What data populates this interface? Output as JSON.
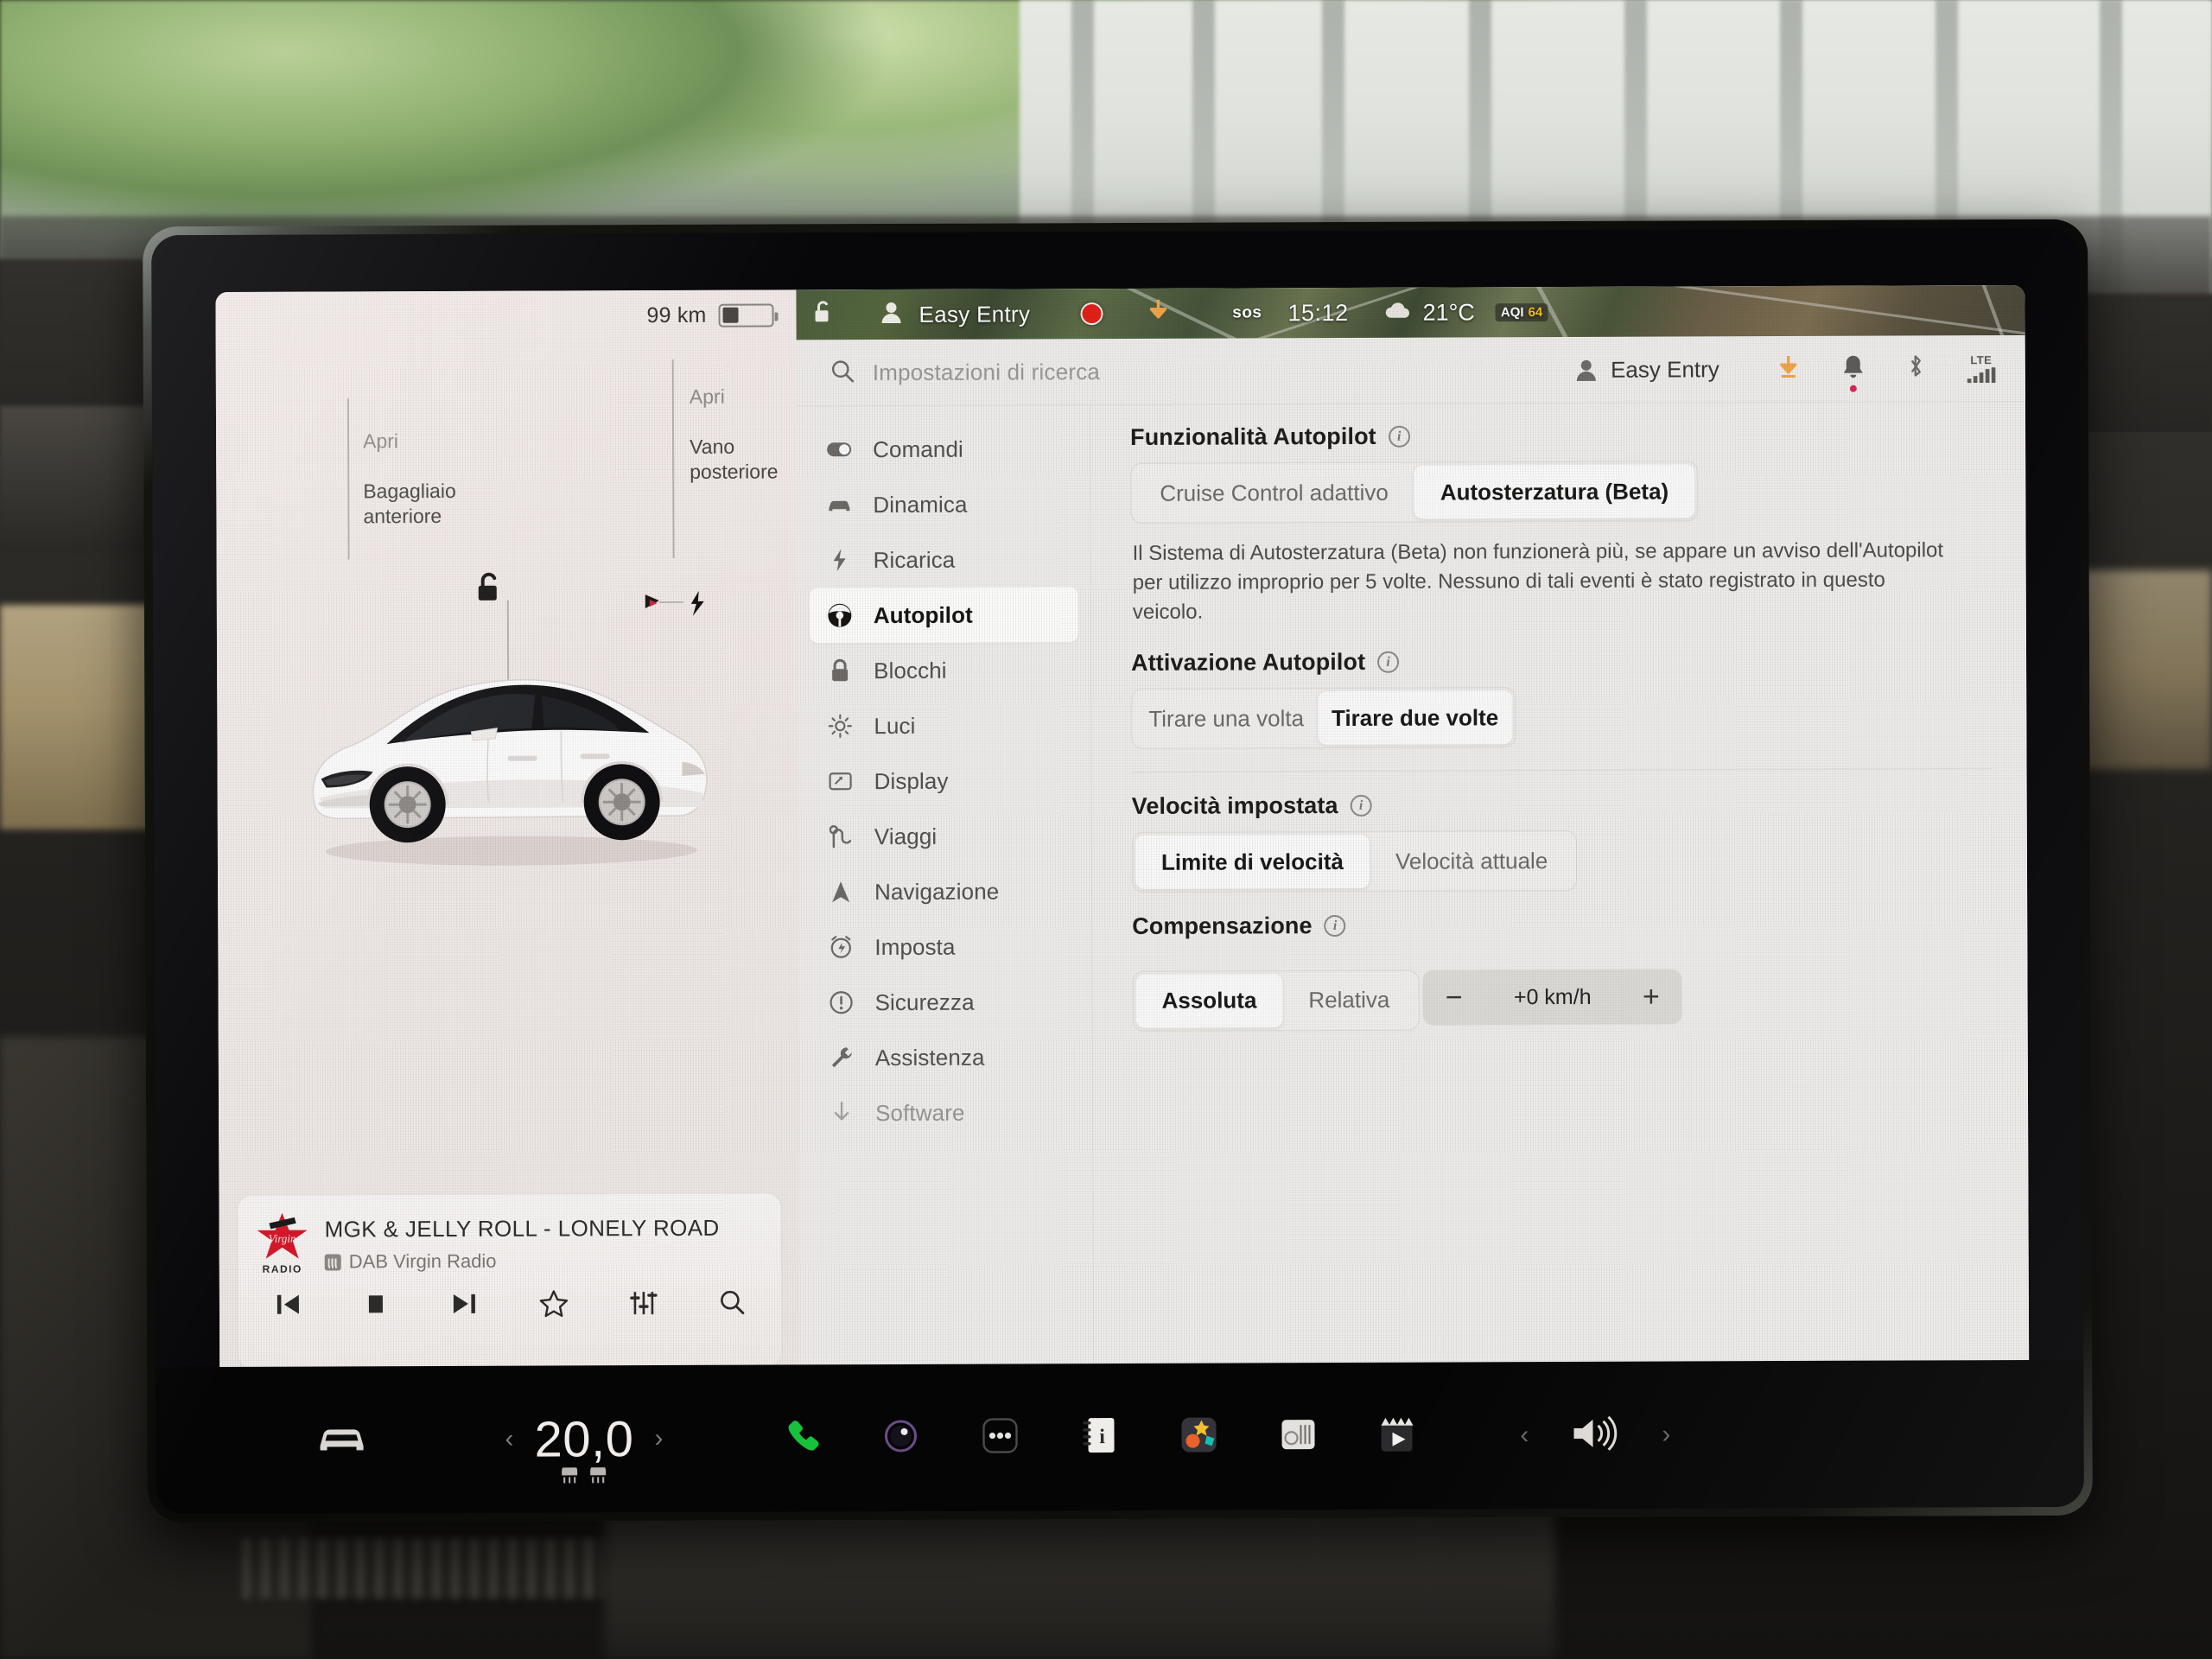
{
  "vehicle_panel": {
    "range_value": "99 km",
    "battery_icon": "battery-icon",
    "front_trunk_label": "Apri",
    "front_trunk_name": "Bagagliaio\nanteriore",
    "rear_trunk_label": "Apri",
    "rear_trunk_name": "Vano\nposteriore",
    "lock_icon": "unlocked-padlock-icon",
    "charge_port_icon": "charge-port-icon",
    "car_image": "tesla-model-3-white"
  },
  "media": {
    "station_logo": "virgin-radio-logo",
    "logo_caption": "RADIO",
    "track_title": "MGK & JELLY ROLL - LONELY ROAD",
    "source": "DAB Virgin Radio",
    "source_badge": "dab-icon",
    "controls": [
      {
        "name": "previous-track-button",
        "icon": "skip-previous-icon"
      },
      {
        "name": "stop-button",
        "icon": "stop-icon"
      },
      {
        "name": "next-track-button",
        "icon": "skip-next-icon"
      },
      {
        "name": "favorite-button",
        "icon": "star-outline-icon"
      },
      {
        "name": "equalizer-button",
        "icon": "equalizer-icon"
      },
      {
        "name": "media-search-button",
        "icon": "search-icon"
      }
    ]
  },
  "status_bar": {
    "lock_icon": "unlocked-padlock-icon",
    "profile_icon": "person-icon",
    "profile_name": "Easy Entry",
    "record_indicator": "sentry-record-icon",
    "navigation_arrow": "download-arrow-icon",
    "sos_label": "sos",
    "time": "15:12",
    "weather_icon": "cloud-icon",
    "temperature": "21°C",
    "aqi_label": "AQI",
    "aqi_value": "64"
  },
  "search": {
    "icon": "search-icon",
    "placeholder": "Impostazioni di ricerca",
    "value": ""
  },
  "header_right": {
    "profile_icon": "person-icon",
    "profile_name": "Easy Entry",
    "icons": [
      {
        "name": "software-download-icon"
      },
      {
        "name": "notification-bell-icon"
      },
      {
        "name": "bluetooth-icon"
      }
    ],
    "connection_label": "LTE",
    "signal_icon": "signal-bars-icon"
  },
  "nav": {
    "items": [
      {
        "label": "Comandi",
        "icon": "toggle-switch-icon",
        "active": false
      },
      {
        "label": "Dinamica",
        "icon": "car-front-icon",
        "active": false
      },
      {
        "label": "Ricarica",
        "icon": "bolt-icon",
        "active": false
      },
      {
        "label": "Autopilot",
        "icon": "steering-wheel-icon",
        "active": true
      },
      {
        "label": "Blocchi",
        "icon": "padlock-icon",
        "active": false
      },
      {
        "label": "Luci",
        "icon": "sun-icon",
        "active": false
      },
      {
        "label": "Display",
        "icon": "display-icon",
        "active": false
      },
      {
        "label": "Viaggi",
        "icon": "trips-icon",
        "active": false
      },
      {
        "label": "Navigazione",
        "icon": "navigation-arrow-icon",
        "active": false
      },
      {
        "label": "Imposta",
        "icon": "alarm-clock-icon",
        "active": false
      },
      {
        "label": "Sicurezza",
        "icon": "warning-circle-icon",
        "active": false
      },
      {
        "label": "Assistenza",
        "icon": "wrench-icon",
        "active": false
      },
      {
        "label": "Software",
        "icon": "download-arrow-icon",
        "active": false
      }
    ]
  },
  "content": {
    "sections": [
      {
        "title": "Funzionalità Autopilot",
        "info_icon": "info-icon",
        "options": [
          {
            "label": "Cruise Control adattivo",
            "selected": false
          },
          {
            "label": "Autosterzatura (Beta)",
            "selected": true
          }
        ],
        "description": "Il Sistema di Autosterzatura (Beta) non funzionerà più, se appare un avviso dell'Autopilot per utilizzo improprio per 5 volte. Nessuno di tali eventi è stato registrato in questo veicolo."
      },
      {
        "title": "Attivazione Autopilot",
        "info_icon": "info-icon",
        "options": [
          {
            "label": "Tirare una volta",
            "selected": false
          },
          {
            "label": "Tirare due volte",
            "selected": true
          }
        ]
      },
      {
        "title": "Velocità impostata",
        "info_icon": "info-icon",
        "options": [
          {
            "label": "Limite di velocità",
            "selected": true
          },
          {
            "label": "Velocità attuale",
            "selected": false
          }
        ]
      },
      {
        "title": "Compensazione",
        "info_icon": "info-icon",
        "options": [
          {
            "label": "Assoluta",
            "selected": true
          },
          {
            "label": "Relativa",
            "selected": false
          }
        ],
        "stepper": {
          "minus_label": "−",
          "value": "+0 km/h",
          "plus_label": "+"
        }
      }
    ]
  },
  "taskbar": {
    "car_icon": "car-front-icon",
    "temp_prev_icon": "chevron-left-icon",
    "temperature": "20,0",
    "temp_next_icon": "chevron-right-icon",
    "seat_heater_left": "seat-heater-icon",
    "seat_heater_right": "seat-heater-icon",
    "apps": [
      {
        "name": "phone-app-icon"
      },
      {
        "name": "camera-app-icon"
      },
      {
        "name": "more-apps-icon"
      },
      {
        "name": "manual-app-icon"
      },
      {
        "name": "toybox-app-icon"
      },
      {
        "name": "radio-app-icon"
      },
      {
        "name": "theater-app-icon"
      }
    ],
    "volume_prev_icon": "chevron-left-icon",
    "volume_icon": "speaker-icon",
    "volume_next_icon": "chevron-right-icon"
  },
  "colors": {
    "accent_red": "#e32119",
    "aqi_yellow": "#f5c518",
    "panel_bg": "#eeecea",
    "car_panel_bg": "#f2ebe9",
    "taskbar_bg": "#050506"
  }
}
